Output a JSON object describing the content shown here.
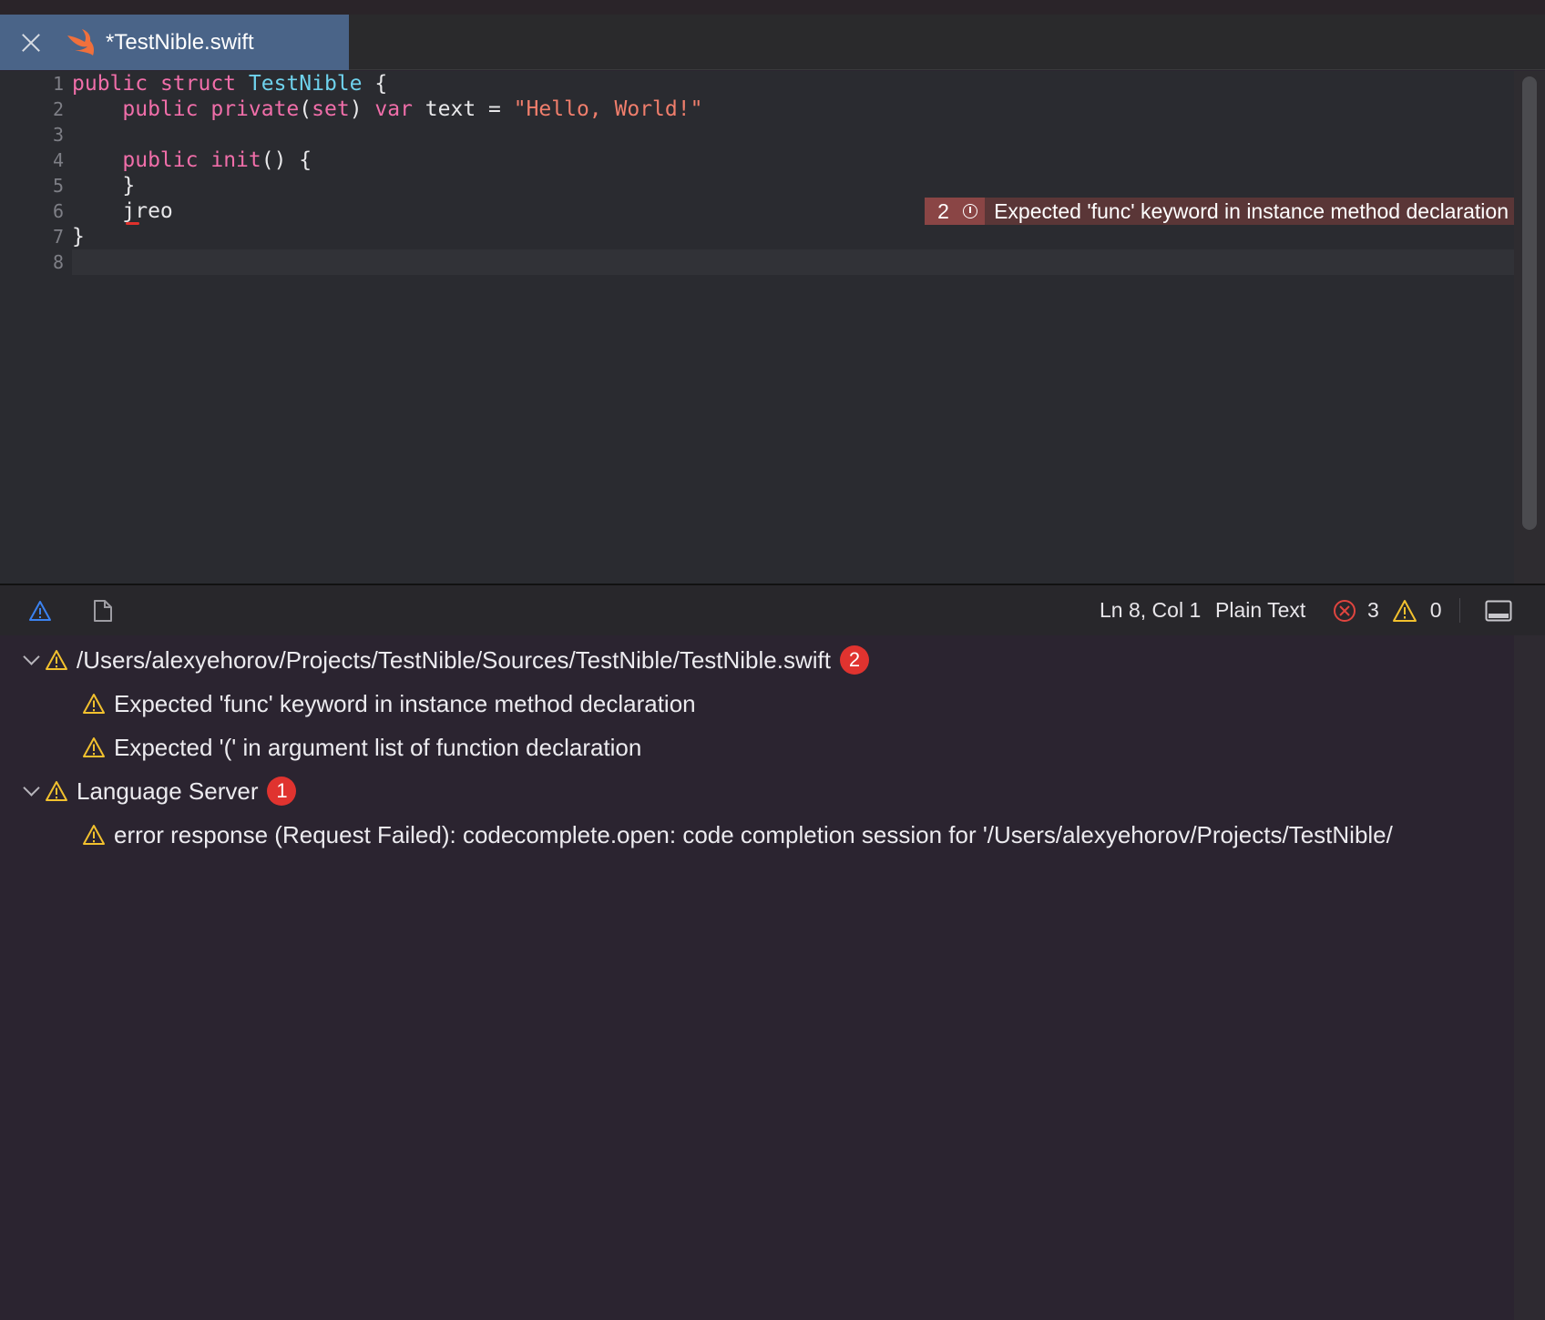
{
  "tab": {
    "title": "*TestNible.swift"
  },
  "editor": {
    "lines": [
      {
        "num": "1",
        "tokens": [
          [
            "kw",
            "public"
          ],
          [
            "",
            ""
          ],
          [
            "kw",
            " struct"
          ],
          [
            "ty",
            " TestNible"
          ],
          [
            "",
            " {"
          ]
        ]
      },
      {
        "num": "2",
        "tokens": [
          [
            "",
            "    "
          ],
          [
            "kw",
            "public"
          ],
          [
            "",
            " "
          ],
          [
            "kw",
            "private"
          ],
          [
            "",
            "("
          ],
          [
            "kw",
            "set"
          ],
          [
            "",
            ")"
          ],
          [
            "kw",
            " var"
          ],
          [
            "",
            " text = "
          ],
          [
            "st",
            "\"Hello, World!\""
          ]
        ]
      },
      {
        "num": "3",
        "tokens": []
      },
      {
        "num": "4",
        "tokens": [
          [
            "",
            "    "
          ],
          [
            "kw",
            "public"
          ],
          [
            "",
            " "
          ],
          [
            "kw",
            "init"
          ],
          [
            "",
            "() {"
          ]
        ]
      },
      {
        "num": "5",
        "tokens": [
          [
            "",
            "    }"
          ]
        ]
      },
      {
        "num": "6",
        "tokens": [
          [
            "",
            "    jreo"
          ]
        ]
      },
      {
        "num": "7",
        "tokens": [
          [
            "",
            "}"
          ]
        ]
      },
      {
        "num": "8",
        "tokens": []
      }
    ],
    "inline_diagnostic": {
      "count": "2",
      "message": "Expected 'func' keyword in instance method declaration"
    }
  },
  "status": {
    "position": "Ln 8, Col 1",
    "language": "Plain Text",
    "errors": "3",
    "warnings": "0"
  },
  "problems": {
    "groups": [
      {
        "label": "/Users/alexyehorov/Projects/TestNible/Sources/TestNible/TestNible.swift",
        "count": "2",
        "items": [
          "Expected 'func' keyword in instance method declaration",
          "Expected '(' in argument list of function declaration"
        ]
      },
      {
        "label": "Language Server",
        "count": "1",
        "items": [
          "error response (Request Failed): codecomplete.open: code completion session for '/Users/alexyehorov/Projects/TestNible/"
        ]
      }
    ]
  },
  "colors": {
    "tab_active": "#4a6488",
    "keyword": "#f06ea9",
    "type": "#6fd2ed",
    "string": "#f07e6c",
    "error_badge": "#e0332f",
    "warning": "#f2c12e"
  },
  "icons": {
    "tab_close": "close-icon",
    "tab_file": "swift-icon",
    "status_problems": "warning-icon",
    "status_output": "file-icon",
    "status_errors": "error-circle-icon",
    "status_warnings": "warning-icon",
    "status_panel": "panel-toggle-icon"
  }
}
